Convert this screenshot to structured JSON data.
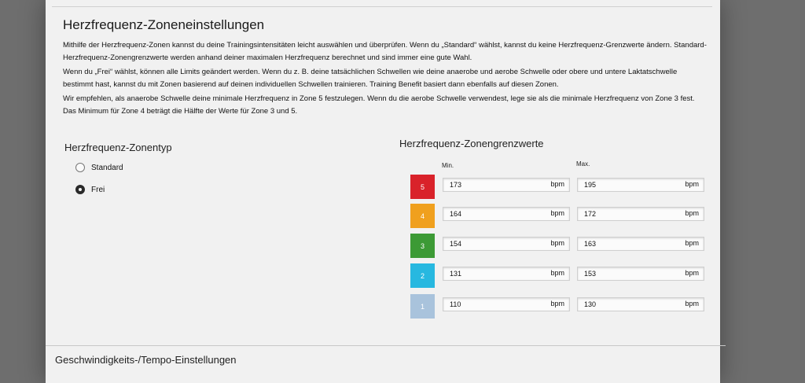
{
  "header": {
    "title": "Herzfrequenz-Zoneneinstellungen"
  },
  "description": {
    "p1": "Mithilfe der Herzfrequenz-Zonen kannst du deine Trainingsintensitäten leicht auswählen und überprüfen. Wenn du „Standard“ wählst, kannst du keine Herzfrequenz-Grenzwerte ändern. Standard-Herzfrequenz-Zonengrenzwerte werden anhand deiner maximalen Herzfrequenz berechnet und sind immer eine gute Wahl.",
    "p2": "Wenn du „Frei“ wählst, können alle Limits geändert werden. Wenn du z. B. deine tatsächlichen Schwellen wie deine anaerobe und aerobe Schwelle oder obere und untere Laktatschwelle bestimmt hast, kannst du mit Zonen basierend auf deinen individuellen Schwellen trainieren. Training Benefit basiert dann ebenfalls auf diesen Zonen.",
    "p3": "Wir empfehlen, als anaerobe Schwelle deine minimale Herzfrequenz in Zone 5 festzulegen. Wenn du die aerobe Schwelle verwendest, lege sie als die minimale Herzfrequenz von Zone 3 fest. Das Minimum für Zone 4 beträgt die Hälfte der Werte für Zone 3 und 5."
  },
  "zone_type": {
    "heading": "Herzfrequenz-Zonentyp",
    "options": [
      {
        "label": "Standard",
        "checked": false
      },
      {
        "label": "Frei",
        "checked": true
      }
    ]
  },
  "zone_limits": {
    "heading": "Herzfrequenz-Zonengrenzwerte",
    "min_label": "Min.",
    "max_label": "Max.",
    "unit": "bpm",
    "zones": [
      {
        "number": "5",
        "color": "#d9222a",
        "min": "173",
        "max": "195"
      },
      {
        "number": "4",
        "color": "#f0a01e",
        "min": "164",
        "max": "172"
      },
      {
        "number": "3",
        "color": "#3c9a35",
        "min": "154",
        "max": "163"
      },
      {
        "number": "2",
        "color": "#27b8e0",
        "min": "131",
        "max": "153"
      },
      {
        "number": "1",
        "color": "#a9c3dc",
        "min": "110",
        "max": "130"
      }
    ]
  },
  "footer": {
    "next_section": "Geschwindigkeits-/Tempo-Einstellungen"
  }
}
